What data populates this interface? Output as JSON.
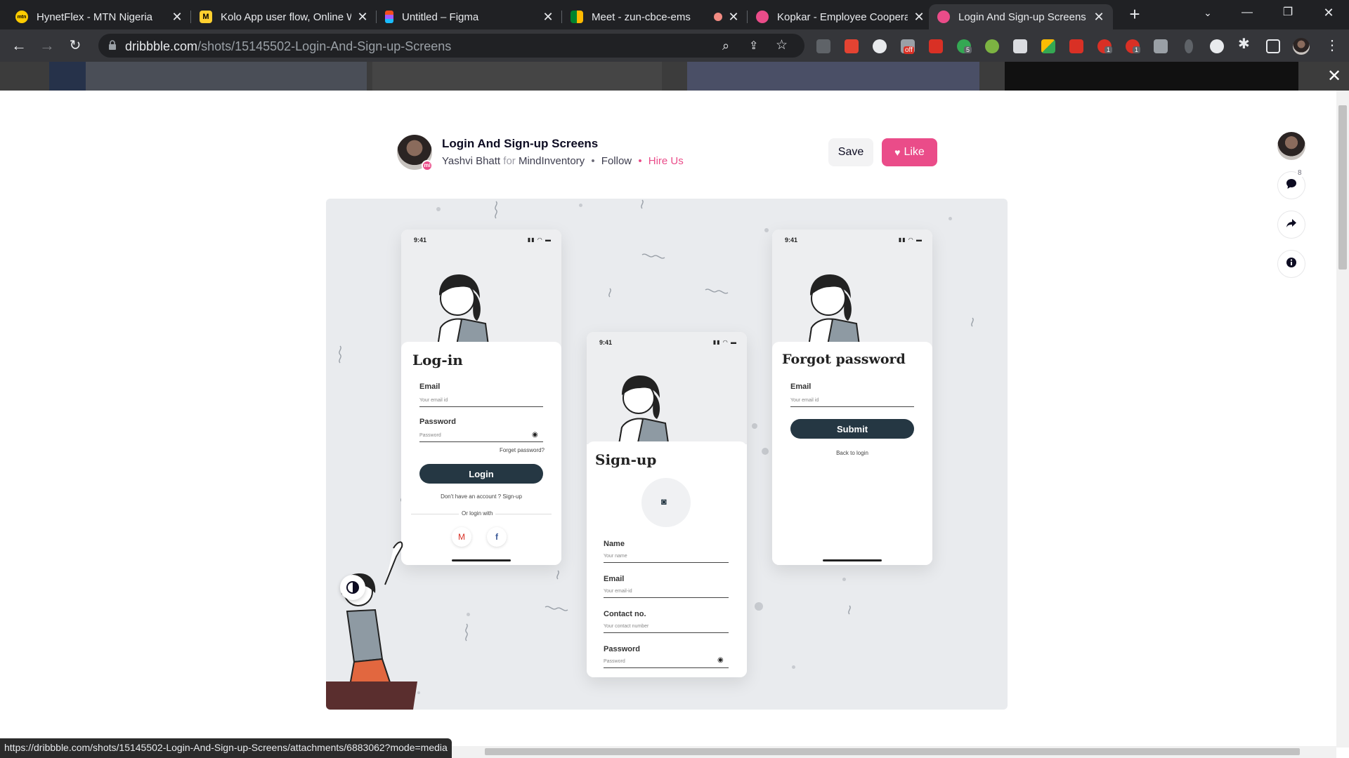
{
  "browser": {
    "tabs": [
      {
        "title": "HynetFlex - MTN Nigeria",
        "fav_color": "#ffcc00",
        "fav_text": "mtn"
      },
      {
        "title": "Kolo App user flow, Online W",
        "fav_color": "#ffd02f",
        "fav_text": "M"
      },
      {
        "title": "Untitled – Figma",
        "fav_color": "#a259ff",
        "fav_text": ""
      },
      {
        "title": "Meet - zun-cbce-ems",
        "fav_color": "#00832d",
        "fav_text": ""
      },
      {
        "title": "Kopkar - Employee Cooperati",
        "fav_color": "#ea4c89",
        "fav_text": ""
      },
      {
        "title": "Login And Sign-up Screens",
        "fav_color": "#ea4c89",
        "fav_text": ""
      }
    ],
    "active_tab": 5,
    "url_host": "dribbble.com",
    "url_path": "/shots/15145502-Login-And-Sign-up-Screens",
    "extension_badges": {
      "off": "off",
      "five": "5",
      "abp": "1",
      "red": "1"
    },
    "status_url": "https://dribbble.com/shots/15145502-Login-And-Sign-up-Screens/attachments/6883062?mode=media"
  },
  "shot": {
    "title": "Login And Sign-up Screens",
    "author": "Yashvi Bhatt",
    "for_text": "for",
    "team": "MindInventory",
    "follow": "Follow",
    "hire": "Hire Us",
    "save_label": "Save",
    "like_label": "Like",
    "comment_count": "8",
    "accent": "#ea4c89"
  },
  "mockup": {
    "time": "9:41",
    "login": {
      "title": "Log-in",
      "email_label": "Email",
      "email_ph": "Your email id",
      "password_label": "Password",
      "password_ph": "Password",
      "forgot": "Forget password?",
      "button": "Login",
      "no_account": "Don't have an account ? Sign-up",
      "or_login": "Or login with"
    },
    "signup": {
      "title": "Sign-up",
      "name_label": "Name",
      "name_ph": "Your name",
      "email_label": "Email",
      "email_ph": "Your email-id",
      "contact_label": "Contact no.",
      "contact_ph": "Your contact number",
      "password_label": "Password",
      "password_ph": "Password"
    },
    "forgot": {
      "title": "Forgot password",
      "email_label": "Email",
      "email_ph": "Your email id",
      "button": "Submit",
      "back": "Back to login"
    }
  }
}
